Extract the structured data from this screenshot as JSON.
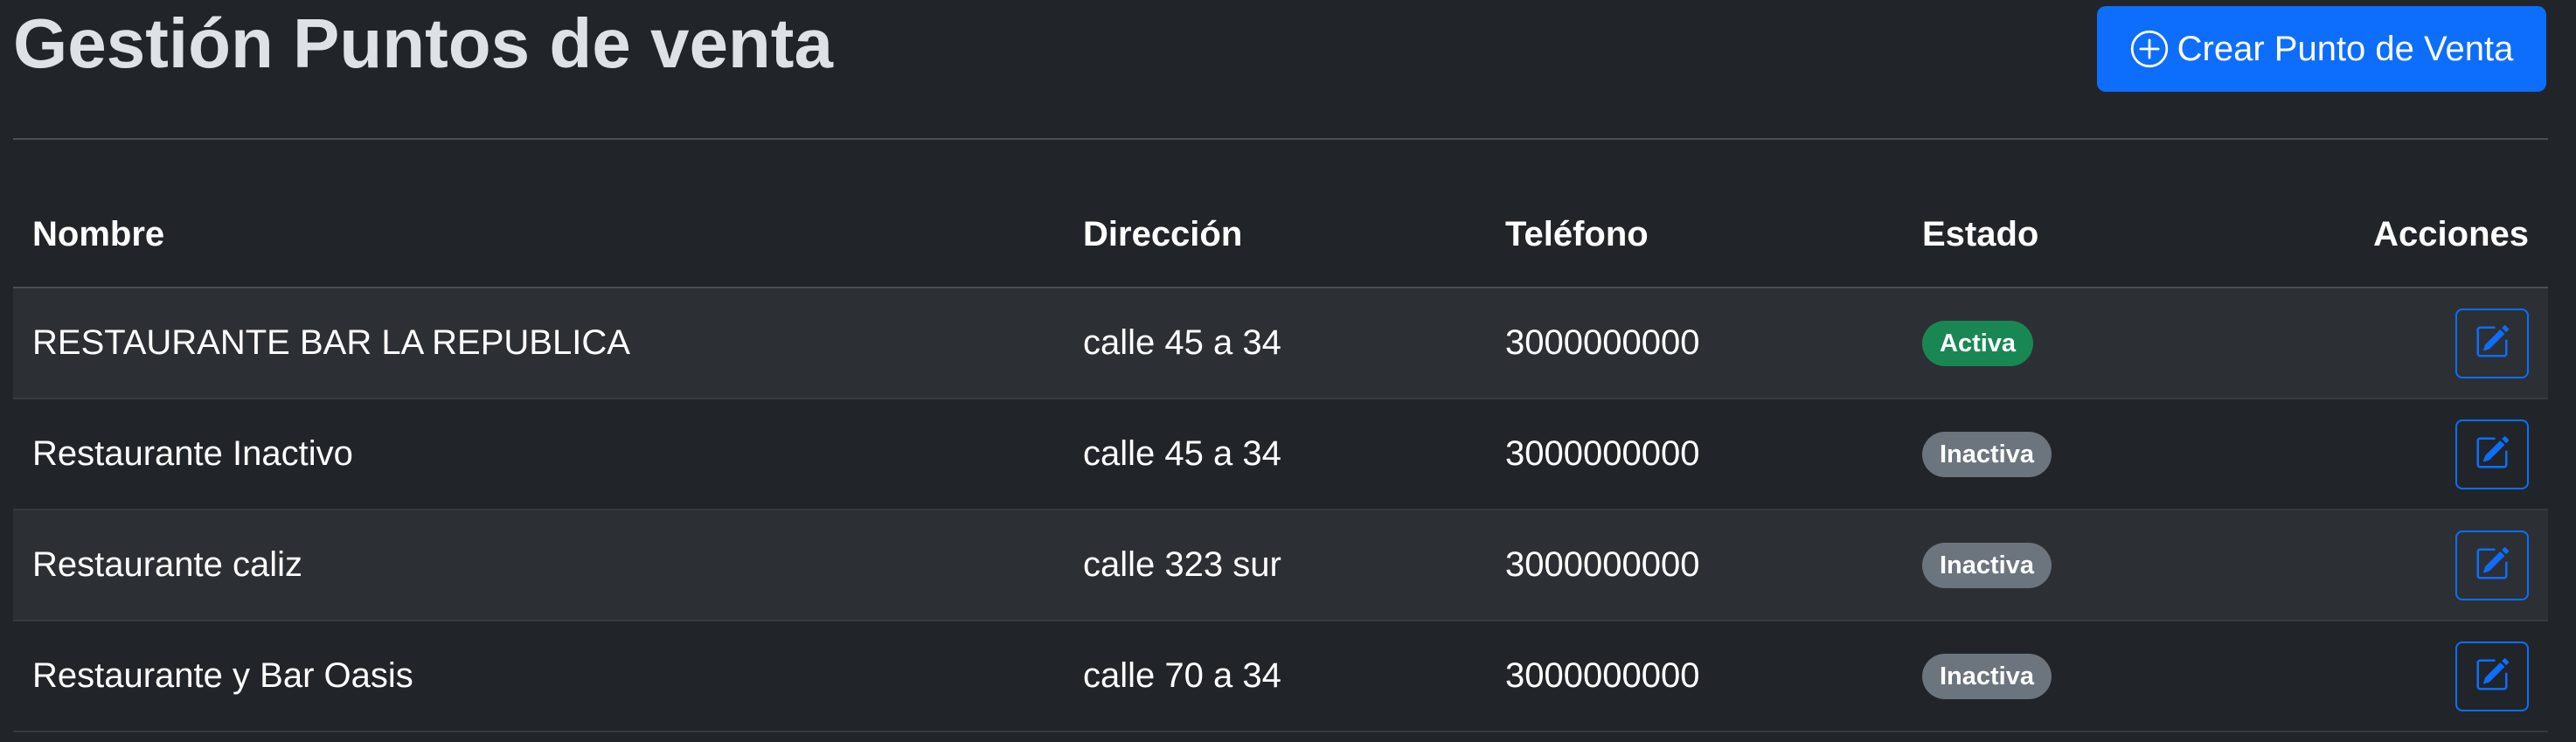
{
  "header": {
    "title": "Gestión Puntos de venta",
    "create_button_label": "Crear Punto de Venta",
    "create_button_icon": "plus-circle-icon"
  },
  "colors": {
    "primary": "#0d6efd",
    "success": "#198754",
    "secondary": "#6c757d",
    "background": "#212529"
  },
  "table": {
    "columns": [
      "Nombre",
      "Dirección",
      "Teléfono",
      "Estado",
      "Acciones"
    ],
    "rows": [
      {
        "nombre": "RESTAURANTE BAR LA REPUBLICA",
        "direccion": "calle 45 a 34",
        "telefono": "3000000000",
        "estado": "Activa",
        "estado_color": "#198754",
        "action_icon": "edit-icon"
      },
      {
        "nombre": "Restaurante Inactivo",
        "direccion": "calle 45 a 34",
        "telefono": "3000000000",
        "estado": "Inactiva",
        "estado_color": "#6c757d",
        "action_icon": "edit-icon"
      },
      {
        "nombre": "Restaurante caliz",
        "direccion": "calle 323 sur",
        "telefono": "3000000000",
        "estado": "Inactiva",
        "estado_color": "#6c757d",
        "action_icon": "edit-icon"
      },
      {
        "nombre": "Restaurante y Bar Oasis",
        "direccion": "calle 70 a 34",
        "telefono": "3000000000",
        "estado": "Inactiva",
        "estado_color": "#6c757d",
        "action_icon": "edit-icon"
      }
    ]
  }
}
